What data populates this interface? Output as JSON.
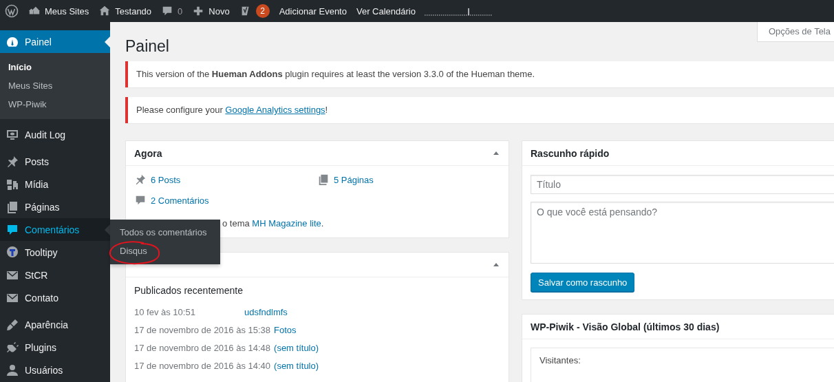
{
  "admin_bar": {
    "items": [
      {
        "kind": "logo"
      },
      {
        "kind": "sites",
        "label": "Meus Sites"
      },
      {
        "kind": "home",
        "label": "Testando"
      },
      {
        "kind": "comments",
        "label": "0"
      },
      {
        "kind": "new",
        "label": "Novo"
      },
      {
        "kind": "seo",
        "badge": "2"
      },
      {
        "kind": "text",
        "label": "Adicionar Evento"
      },
      {
        "kind": "text",
        "label": "Ver Calendário"
      },
      {
        "kind": "gauge"
      }
    ]
  },
  "screen_options": {
    "label": "Opções de Tela"
  },
  "sidebar": {
    "groups": [
      [
        {
          "label": "Painel",
          "selected": true,
          "expanded": false,
          "submenu": [
            {
              "label": "Início",
              "selected": true
            },
            {
              "label": "Meus Sites",
              "selected": false
            },
            {
              "label": "WP-Piwik",
              "selected": false
            }
          ]
        }
      ],
      [
        {
          "label": "Audit Log",
          "selected": false,
          "expanded": false
        }
      ],
      [
        {
          "label": "Posts",
          "selected": false,
          "expanded": false
        },
        {
          "label": "Mídia",
          "selected": false,
          "expanded": false
        },
        {
          "label": "Páginas",
          "selected": false,
          "expanded": false
        },
        {
          "label": "Comentários",
          "selected": false,
          "expanded": true,
          "submenu": [
            {
              "label": "Todos os comentários",
              "selected": false
            },
            {
              "label": "Disqus",
              "selected": false
            }
          ]
        },
        {
          "label": "Tooltipy",
          "selected": false,
          "expanded": false
        },
        {
          "label": "StCR",
          "selected": false,
          "expanded": false
        },
        {
          "label": "Contato",
          "selected": false,
          "expanded": false
        }
      ],
      [
        {
          "label": "Aparência",
          "selected": false,
          "expanded": false
        },
        {
          "label": "Plugins",
          "selected": false,
          "expanded": false
        },
        {
          "label": "Usuários",
          "selected": false,
          "expanded": false
        }
      ]
    ]
  },
  "page": {
    "title": "Painel",
    "notices": [
      {
        "text": "This version of the **Hueman Addons** plugin requires at least the version 3.3.0 of the Hueman theme."
      },
      {
        "text": "Please configure your ",
        "link": "Google Analytics settings",
        "after": "!"
      }
    ],
    "at_a_glance": {
      "title": "Agora",
      "expanded": true,
      "stats": [
        {
          "kind": "posts",
          "label": "6 Posts"
        },
        {
          "kind": "pages",
          "label": "5 Páginas"
        },
        {
          "kind": "comments",
          "label": "2 Comentários"
        }
      ],
      "theme_line": {
        "text": "o tema ",
        "link": "MH Magazine lite",
        "after": "."
      }
    },
    "activity": {
      "expanded": true,
      "subtitle": "Publicados recentemente",
      "posts": [
        {
          "date": "10 fev às 10:51",
          "title": "udsfndlmfs"
        },
        {
          "date": "17 de novembro de 2016 às 15:38",
          "title": "Fotos"
        },
        {
          "date": "17 de novembro de 2016 às 14:48",
          "title": "(sem título)"
        },
        {
          "date": "17 de novembro de 2016 às 14:40",
          "title": "(sem título)"
        }
      ]
    },
    "quick_draft": {
      "title": "Rascunho rápido",
      "title_placeholder": "Título",
      "content_placeholder": "O que você está pensando?",
      "button": "Salvar como rascunho"
    },
    "piwik": {
      "title": "WP-Piwik - Visão Global (últimos 30 dias)",
      "label": "Visitantes:"
    }
  },
  "annotation": {
    "kind": "circle",
    "color": "#e0141e"
  }
}
